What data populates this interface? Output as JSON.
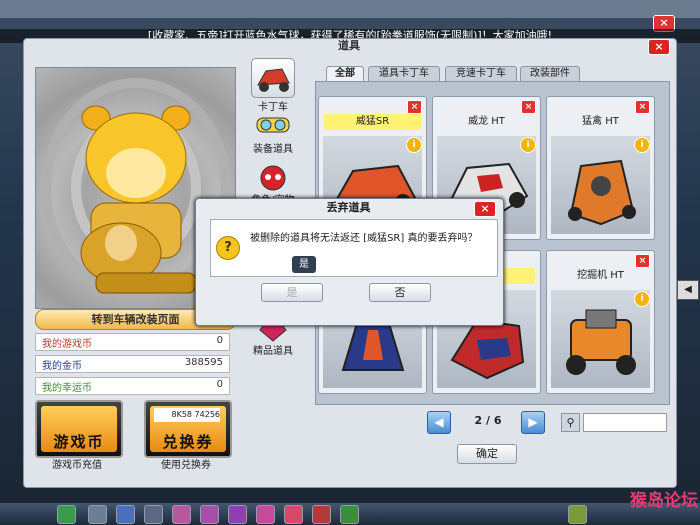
{
  "ticker": "[收藏家、五帝]打开蓝色水气球，获得了稀有的[跆拳道服饰(无限制)]！大家加油哦!",
  "window": {
    "title": "道具",
    "close": "×"
  },
  "avatar_panel": {
    "garage_link": "转到车辆改装页面"
  },
  "stats": [
    {
      "label": "我的游戏币",
      "value": "0",
      "color": "#c0392b"
    },
    {
      "label": "我的金币",
      "value": "388595",
      "color": "#1f3f8f"
    },
    {
      "label": "我的幸运币",
      "value": "0",
      "color": "#3c8d2f"
    }
  ],
  "big_buttons": [
    {
      "text": "游戏币",
      "caption": "游戏币充值"
    },
    {
      "text": "兑换券",
      "caption": "使用兑换券",
      "barcode": "8K58 74256"
    }
  ],
  "categories": [
    {
      "label": "卡丁车",
      "icon": "kart-icon"
    },
    {
      "label": "装备道具",
      "icon": "goggles-icon"
    },
    {
      "label": "角色/宠物",
      "icon": "character-icon"
    },
    {
      "label": "精品道具",
      "icon": "gem-icon"
    }
  ],
  "tabs": [
    {
      "label": "全部",
      "active": true
    },
    {
      "label": "道具卡丁车",
      "active": false
    },
    {
      "label": "竞速卡丁车",
      "active": false
    },
    {
      "label": "改装部件",
      "active": false
    }
  ],
  "items": [
    {
      "name": "威猛SR",
      "highlight": true,
      "color": "#e0562a"
    },
    {
      "name": "威龙 HT",
      "highlight": false,
      "color": "#d8d8d8"
    },
    {
      "name": "猛禽 HT",
      "highlight": false,
      "color": "#e07a2a"
    },
    {
      "name": "",
      "highlight": false,
      "color": "#2a3a8a"
    },
    {
      "name": "",
      "highlight": true,
      "color": "#c02a2a"
    },
    {
      "name": "挖掘机 HT",
      "highlight": false,
      "color": "#e8882a"
    }
  ],
  "pager": {
    "text": "2 / 6",
    "prev": "◀",
    "next": "▶"
  },
  "confirm_label": "确定",
  "dialog": {
    "title": "丢弃道具",
    "message": "被删除的道具将无法返还 [威猛SR] 真的要丢弃吗？",
    "tooltip": "是",
    "yes": "是",
    "no": "否"
  },
  "watermark": "猴岛论坛"
}
